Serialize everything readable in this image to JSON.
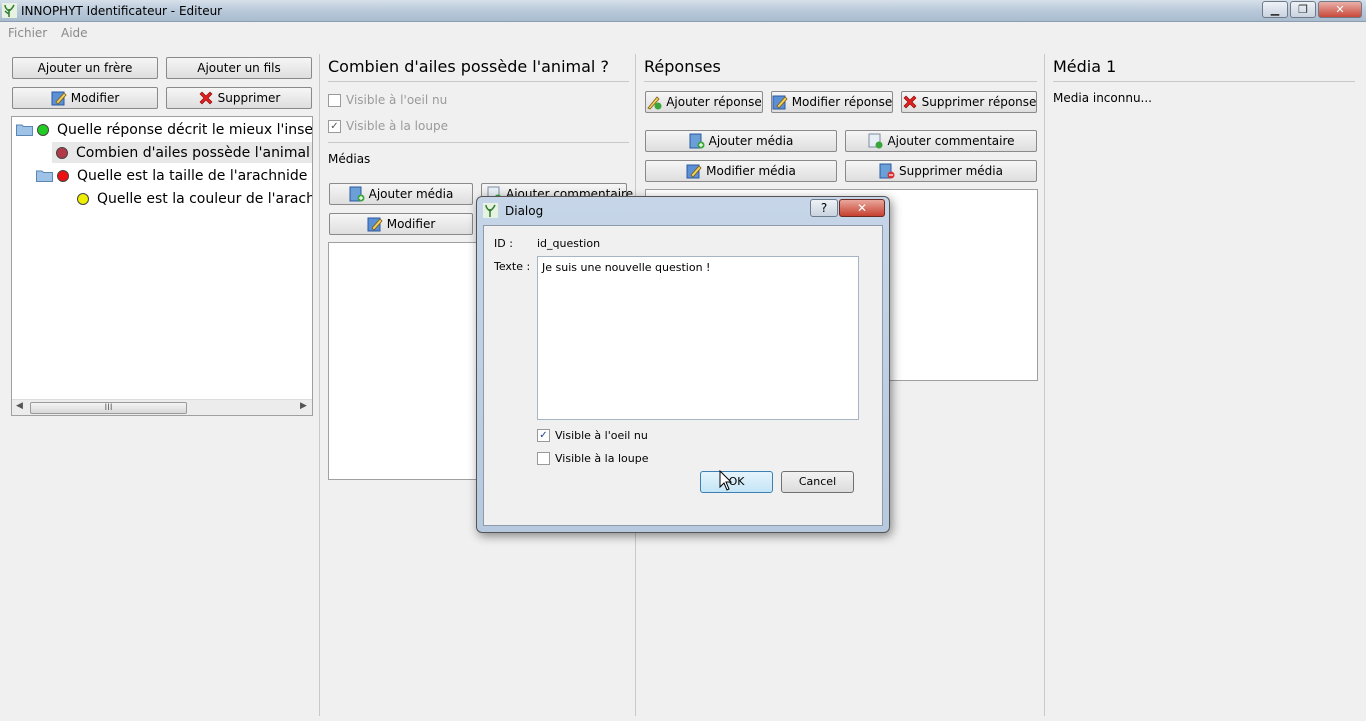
{
  "window": {
    "title": "INNOPHYT Identificateur - Editeur",
    "controls": [
      "▁",
      "❐",
      "✕"
    ]
  },
  "menu": [
    "Fichier",
    "Aide"
  ],
  "left_panel": {
    "buttons": {
      "add_sibling": "Ajouter un frère",
      "add_child": "Ajouter un fils",
      "edit": "Modifier",
      "delete": "Supprimer"
    },
    "tree": [
      {
        "label": "Quelle réponse décrit le mieux l'insec",
        "dot_color": "#22cc22",
        "folder": true
      },
      {
        "label": "Combien d'ailes possède l'animal",
        "dot_color": "#b23a48",
        "folder": false,
        "selected": true
      },
      {
        "label": "Quelle est la taille de l'arachnide ?",
        "dot_color": "#ee1111",
        "folder": true
      },
      {
        "label": "Quelle est la couleur de l'arachr",
        "dot_color": "#eeee00",
        "folder": false
      }
    ],
    "scroll_grip": "III"
  },
  "question_panel": {
    "title": "Combien d'ailes possède l'animal ?",
    "visible_naked_eye": {
      "label": "Visible à l'oeil nu",
      "checked": false
    },
    "visible_magnifier": {
      "label": "Visible à la loupe",
      "checked": true
    },
    "media_label": "Médias",
    "add_media": "Ajouter média",
    "add_comment": "Ajouter commentaire",
    "edit": "Modifier"
  },
  "answers_panel": {
    "title": "Réponses",
    "add_answer": "Ajouter réponse",
    "edit_answer": "Modifier réponse",
    "delete_answer": "Supprimer réponse",
    "add_media": "Ajouter média",
    "add_comment": "Ajouter commentaire",
    "edit_media": "Modifier média",
    "delete_media": "Supprimer média"
  },
  "media_panel": {
    "title": "Média 1",
    "status": "Media inconnu..."
  },
  "dialog": {
    "title": "Dialog",
    "help": "?",
    "close": "✕",
    "id_label": "ID :",
    "id_value": "id_question",
    "text_label": "Texte :",
    "text_value": "Je suis une nouvelle question !",
    "visible_naked_eye": {
      "label": "Visible à l'oeil nu",
      "checked": true
    },
    "visible_magnifier": {
      "label": "Visible à la loupe",
      "checked": false
    },
    "ok": "OK",
    "cancel": "Cancel"
  }
}
